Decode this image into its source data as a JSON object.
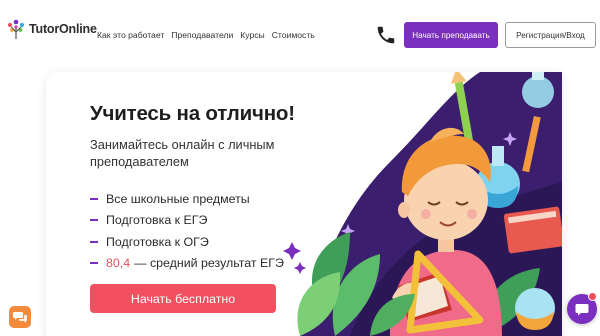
{
  "header": {
    "logo_text_a": "Tutor",
    "logo_text_b": "Online",
    "nav": [
      {
        "label": "Как это работает"
      },
      {
        "label": "Преподаватели"
      },
      {
        "label": "Курсы"
      },
      {
        "label": "Стоимость"
      }
    ],
    "teach_button": "Начать преподавать",
    "register_button": "Регистрация/Вход"
  },
  "hero": {
    "title": "Учитесь на отлично!",
    "subtitle": "Занимайтесь онлайн с личным преподавателем",
    "features": [
      {
        "text": "Все школьные предметы"
      },
      {
        "text": "Подготовка к ЕГЭ"
      },
      {
        "text": "Подготовка к ОГЭ"
      }
    ],
    "stat_value": "80,4",
    "stat_text": "— средний результат ЕГЭ",
    "cta": "Начать бесплатно"
  },
  "colors": {
    "brand_purple": "#7b2fbe",
    "cta_red": "#f25060",
    "chat_orange": "#f48a3c"
  },
  "icons": {
    "phone": "phone-icon",
    "chat_left": "chat-bubbles-icon",
    "chat_right": "chat-icon"
  }
}
